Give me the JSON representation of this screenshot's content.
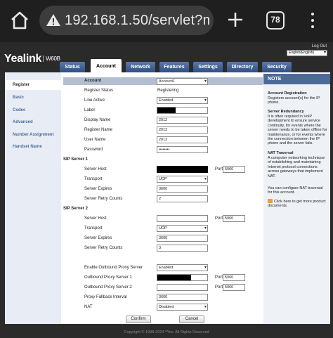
{
  "browser": {
    "url": "192.168.1.50/servlet?m=",
    "tab_count": "78"
  },
  "header": {
    "brand": "Yealink",
    "model": "W60B",
    "logout": "Log Out",
    "language": "English(English)"
  },
  "topnav": {
    "tabs": [
      "Status",
      "Account",
      "Network",
      "Features",
      "Settings",
      "Directory",
      "Security"
    ],
    "active": "Account"
  },
  "leftnav": {
    "items": [
      "Register",
      "Basic",
      "Codec",
      "Advanced",
      "Number Assignment",
      "Handset Name"
    ],
    "active": "Register"
  },
  "form": {
    "account_label": "Account",
    "account_value": "Account1",
    "register_status_label": "Register Status",
    "register_status_value": "Registering",
    "line_active_label": "Line Active",
    "line_active_value": "Enabled",
    "label_label": "Label",
    "display_name_label": "Display Name",
    "display_name_value": "2012",
    "register_name_label": "Register Name",
    "register_name_value": "2012",
    "user_name_label": "User Name",
    "user_name_value": "2012",
    "password_label": "Password",
    "password_value": "••••••••",
    "sip1": {
      "title": "SIP Server 1",
      "host_label": "Server Host",
      "port_label": "Port",
      "port_value": "5060",
      "transport_label": "Transport",
      "transport_value": "UDP",
      "expires_label": "Server Expires",
      "expires_value": "3600",
      "retry_label": "Server Retry Counts",
      "retry_value": "2"
    },
    "sip2": {
      "title": "SIP Server 2",
      "host_label": "Server Host",
      "port_label": "Port",
      "port_value": "5060",
      "transport_label": "Transport",
      "transport_value": "UDP",
      "expires_label": "Server Expires",
      "expires_value": "3600",
      "retry_label": "Server Retry Counts",
      "retry_value": "3"
    },
    "outbound_enable_label": "Enable Outbound Proxy Server",
    "outbound_enable_value": "Enabled",
    "proxy1_label": "Outbound Proxy Server 1",
    "proxy1_port_label": "Port",
    "proxy1_port_value": "5060",
    "proxy2_label": "Outbound Proxy Server 2",
    "proxy2_port_label": "Port",
    "proxy2_port_value": "5060",
    "fallback_label": "Proxy Fallback Interval",
    "fallback_value": "3600",
    "nat_label": "NAT",
    "nat_value": "Disabled",
    "confirm": "Confirm",
    "cancel": "Cancel"
  },
  "note": {
    "title": "NOTE",
    "h1": "Account Registration",
    "p1": "Registers account(s) for the IP phone.",
    "h2": "Server Redundancy",
    "p2": "It is often required in VoIP development to ensure service continuity, for events where the server needs to be taken offline for maintenance, or for events where the connection between the IP phone and the server fails.",
    "h3": "NAT Traversal",
    "p3": "A computer networking technique of establishing and maintaining Internet protocol connections across gateways that implement NAT.",
    "p4": "You can configure NAT traversal for this account.",
    "link": "Click here to get more product documents."
  },
  "footer": "Copyright © 1998-2024 **Inc. All Rights Reserved"
}
